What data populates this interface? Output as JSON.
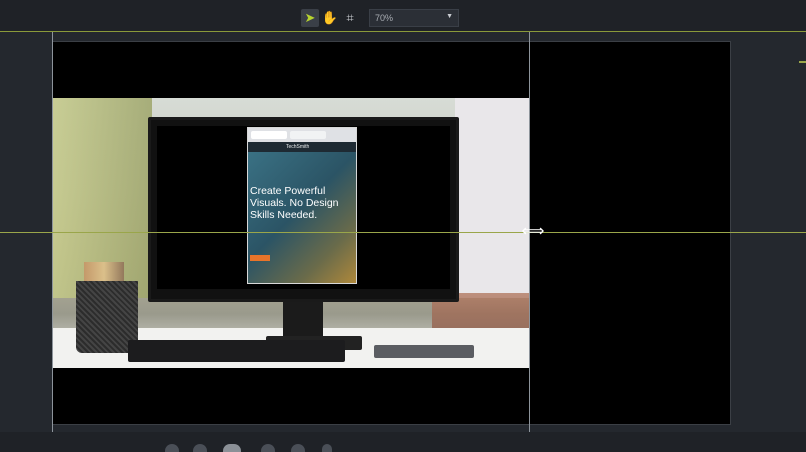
{
  "toolbar": {
    "tools": [
      {
        "name": "select-tool",
        "glyph": "➤",
        "active": true
      },
      {
        "name": "pan-tool",
        "glyph": "✋",
        "active": false
      },
      {
        "name": "crop-tool",
        "glyph": "⌗",
        "active": false
      }
    ],
    "zoom_value": "70%",
    "zoom_caret": "▼"
  },
  "canvas": {
    "phone_brand": "TechSmith",
    "headline": "Create Powerful Visuals. No Design Skills Needed.",
    "cursor_glyph": "⟺"
  },
  "colors": {
    "accent_guide": "#9aa64a",
    "panel_bg": "#252930",
    "cta_orange": "#e8742a"
  }
}
